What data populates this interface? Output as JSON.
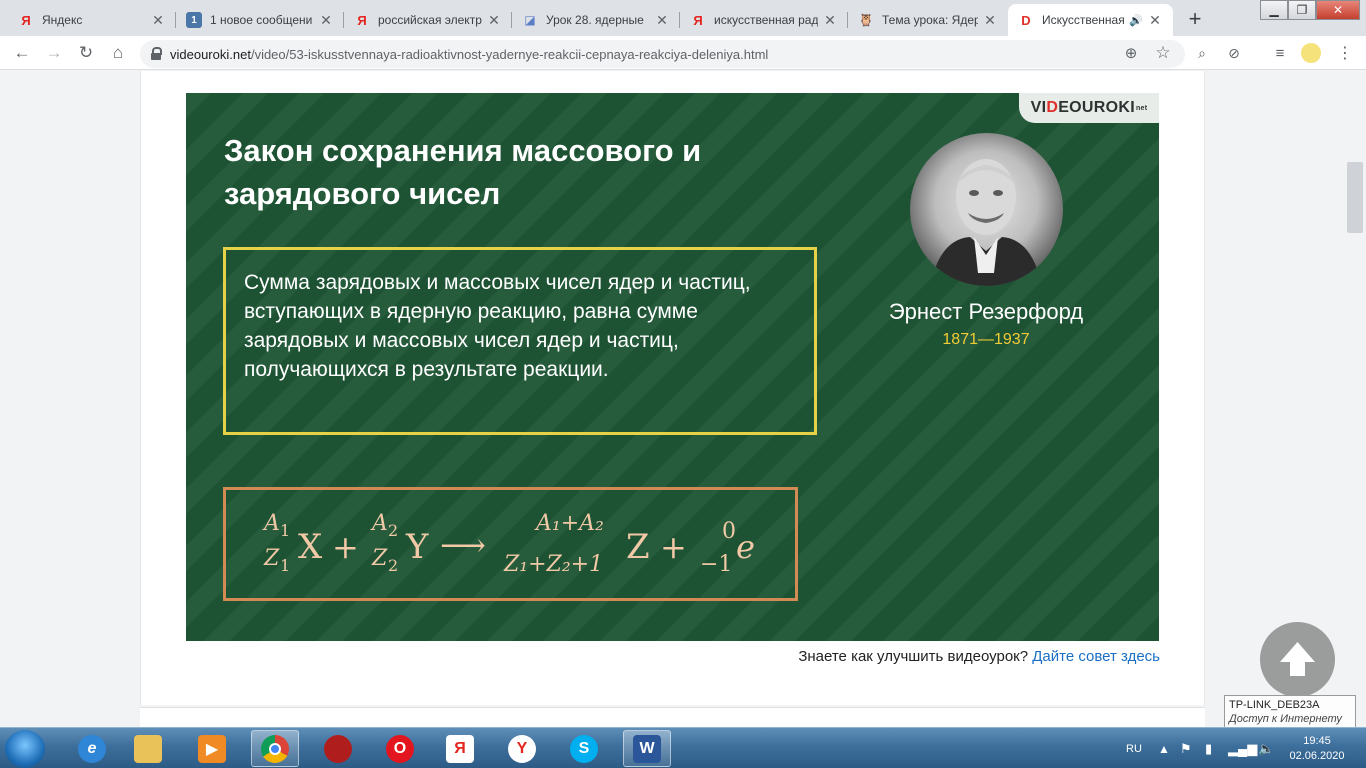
{
  "browser": {
    "tabs": [
      {
        "title": "Яндекс",
        "icon": "yandex-icon"
      },
      {
        "title": "1 новое сообщени",
        "icon": "vk-icon"
      },
      {
        "title": "российская электр",
        "icon": "yandex-icon"
      },
      {
        "title": "Урок 28. ядерные",
        "icon": "doc-icon"
      },
      {
        "title": "искусственная рад",
        "icon": "yandex-icon"
      },
      {
        "title": "Тема урока: Ядерн",
        "icon": "owl-icon"
      },
      {
        "title": "Искусственная",
        "icon": "videouroki-icon",
        "active": true,
        "playing_audio": true
      }
    ],
    "new_tab": "+",
    "url_host": "videouroki.net",
    "url_path": "/video/53-iskusstvennaya-radioaktivnost-yadernye-reakcii-cepnaya-reakciya-deleniya.html"
  },
  "slide": {
    "logo_left": "VI",
    "logo_red": "D",
    "logo_right": "EOUROKI",
    "logo_sup": "net",
    "title_line1": "Закон сохранения массового и",
    "title_line2": "зарядового чисел",
    "law_text": "Сумма зарядовых и массовых чисел ядер и частиц, вступающих в ядерную реакцию, равна сумме зарядовых и массовых чисел ядер и частиц, получающихся в результате реакции.",
    "person_name": "Эрнест Резерфорд",
    "person_years": "1871—1937",
    "formula": {
      "A1": "A",
      "A1_sub": "1",
      "Z1": "Z",
      "Z1_sub": "1",
      "X": "X",
      "plus": "+",
      "A2": "A",
      "A2_sub": "2",
      "Z2": "Z",
      "Z2_sub": "2",
      "Y": "Y",
      "arrow": "⟶",
      "top": "A₁+A₂",
      "bottom": "Z₁+Z₂+1",
      "Z": "Z",
      "e_top": "0",
      "e_bottom": "−1",
      "e": "e"
    }
  },
  "tip": {
    "text": "Знаете как улучшить видеоурок?",
    "link": "Дайте совет здесь"
  },
  "wifi_tooltip": {
    "ssid": "TP-LINK_DEB23A",
    "status": "Доступ к Интернету"
  },
  "taskbar": {
    "lang": "RU",
    "time": "19:45",
    "date": "02.06.2020"
  },
  "colors": {
    "slide_bg": "#1e5535",
    "law_border": "#e7d245",
    "formula_border": "#d48a54",
    "years": "#f2cc35"
  }
}
